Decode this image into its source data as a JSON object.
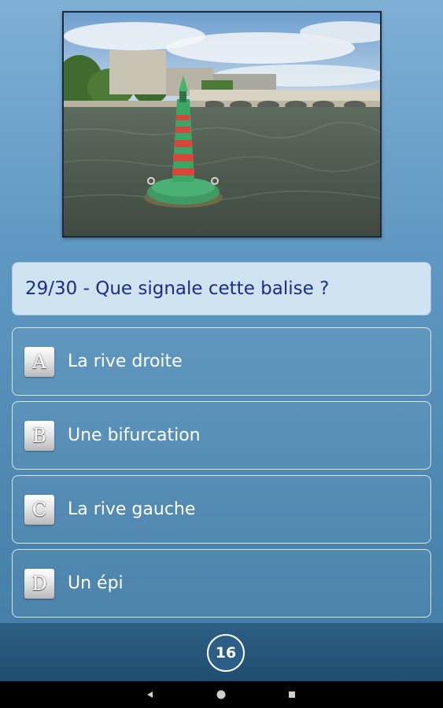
{
  "photo": {
    "subject": "green-red-buoy-on-river"
  },
  "question": {
    "progress": "29/30",
    "separator": " - ",
    "text": "Que signale cette balise ?"
  },
  "answers": [
    {
      "letter": "A",
      "label": "La rive droite"
    },
    {
      "letter": "B",
      "label": "Une bifurcation"
    },
    {
      "letter": "C",
      "label": "La rive gauche"
    },
    {
      "letter": "D",
      "label": "Un épi"
    }
  ],
  "footer": {
    "counter": "16"
  },
  "nav": {
    "back_icon": "back-triangle-icon",
    "home_icon": "home-circle-icon",
    "recent_icon": "recents-square-icon"
  },
  "colors": {
    "question_text": "#1c2b8f",
    "question_bg": "#cfe3f1",
    "bottom_bar": "#1f4d70"
  }
}
